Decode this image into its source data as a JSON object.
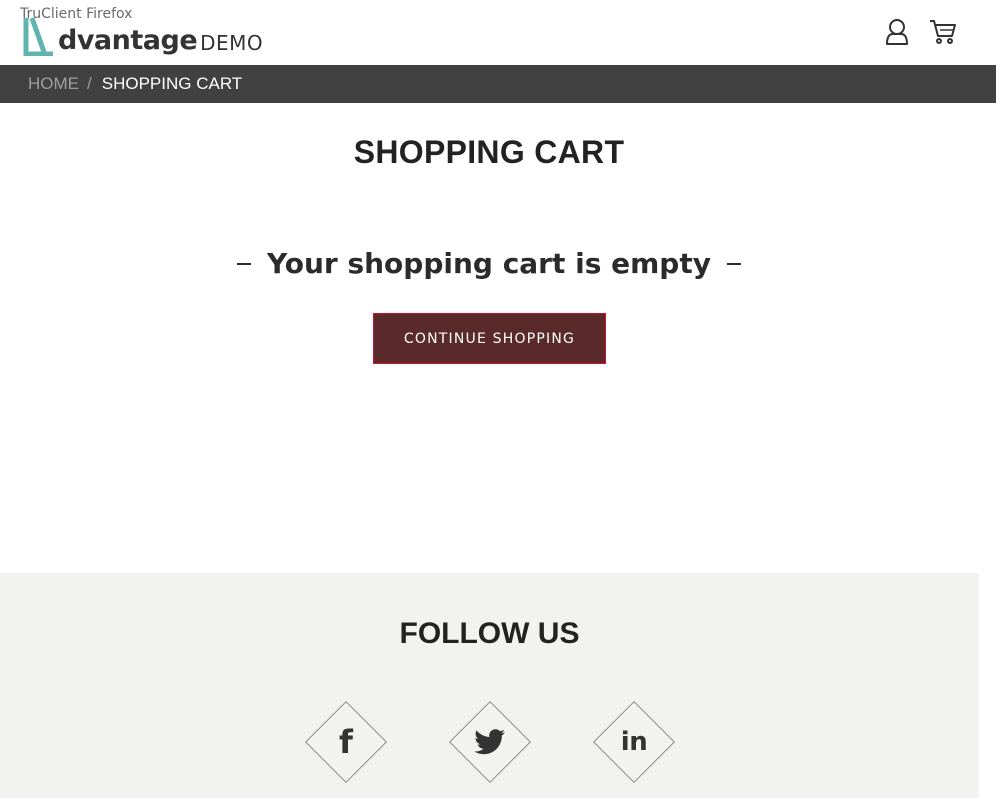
{
  "overlay": {
    "text": "TruClient Firefox"
  },
  "header": {
    "logo_word": "dvantage",
    "logo_suffix": "DEMO",
    "user_icon": "user-icon",
    "cart_icon": "cart-icon"
  },
  "breadcrumb": {
    "home": "HOME",
    "separator": "/",
    "current": "SHOPPING CART"
  },
  "main": {
    "title": "SHOPPING CART",
    "empty_message": "Your shopping cart is empty",
    "continue_button": "CONTINUE SHOPPING"
  },
  "footer": {
    "title": "FOLLOW US",
    "social": [
      {
        "name": "facebook",
        "icon": "facebook-icon",
        "glyph": "f"
      },
      {
        "name": "twitter",
        "icon": "twitter-icon"
      },
      {
        "name": "linkedin",
        "icon": "linkedin-icon",
        "glyph": "in"
      }
    ]
  },
  "colors": {
    "teal_accent": "#5fb4b0",
    "breadcrumb_bg": "#414141",
    "button_bg": "#5a2a2a",
    "button_border": "#d0112b",
    "footer_bg": "#f2f2f0"
  }
}
